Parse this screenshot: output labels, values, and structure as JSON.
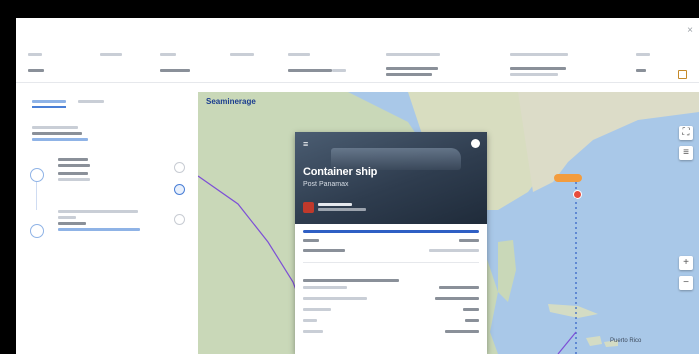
{
  "header": {
    "columns": 10
  },
  "row": {},
  "sidebar": {
    "tabs": [
      {
        "active": true
      },
      {
        "active": false
      }
    ],
    "route": {
      "stops": 2
    }
  },
  "map": {
    "tag": "Seaminerage",
    "labels": {
      "puerto_rico": "Puerto Rico"
    },
    "controls": [
      "fullscreen-icon",
      "layers-icon",
      "zoom-in-icon",
      "zoom-out-icon"
    ]
  },
  "vessel_card": {
    "title": "Container ship",
    "subtitle": "Post Panamax",
    "colors": {
      "hero": "#2f3d4f",
      "flag": "#c0392b",
      "progress": "#2f5fc4"
    },
    "voyage_progress": 1.0
  }
}
